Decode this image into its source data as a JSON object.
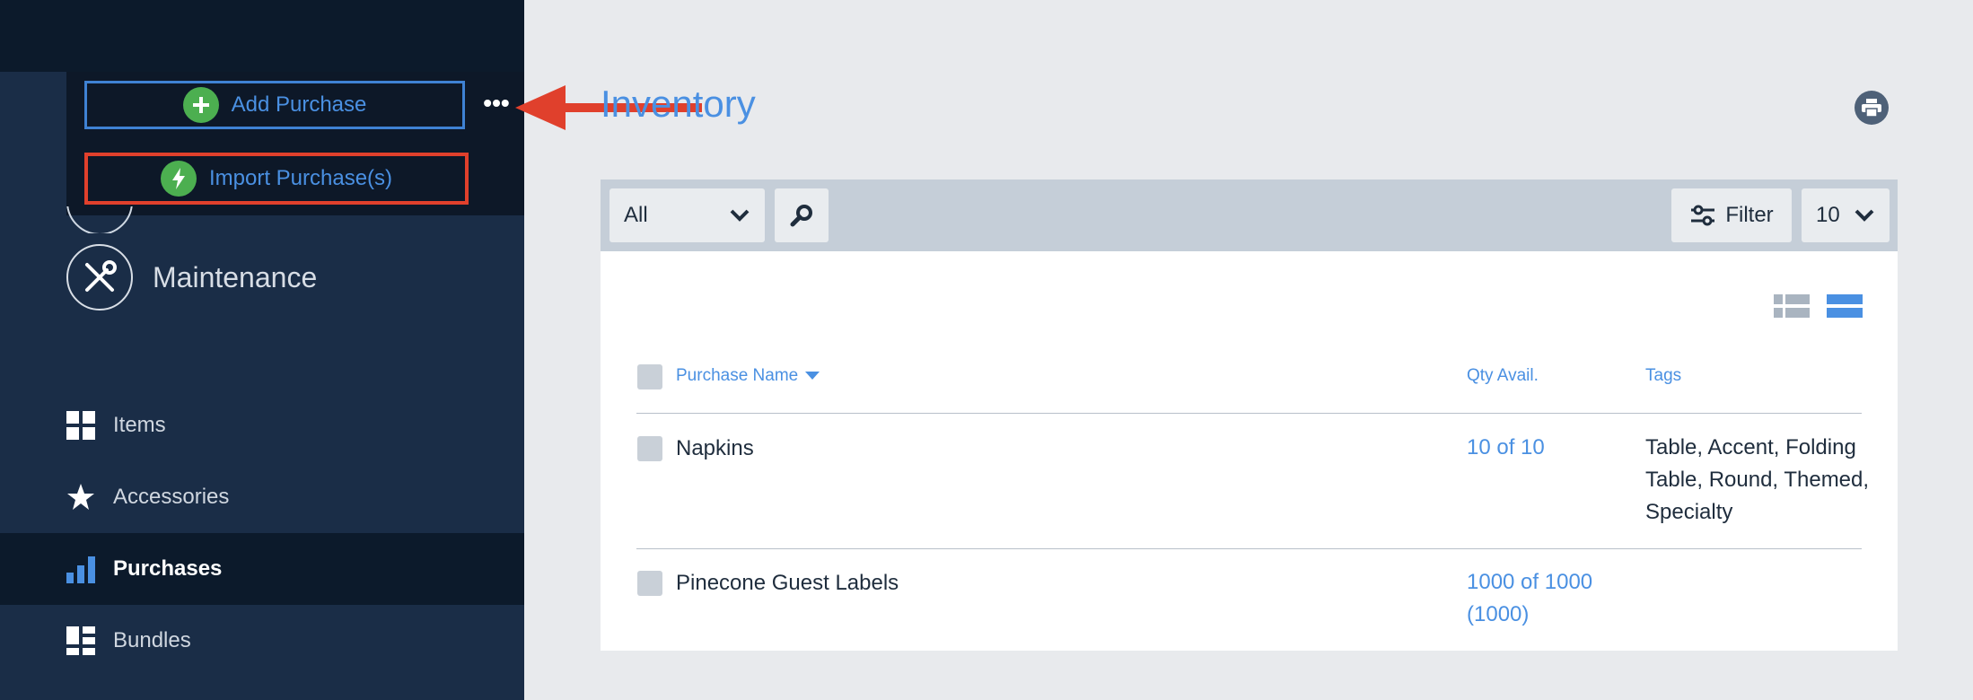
{
  "menu": {
    "add_label": "Add Purchase",
    "import_label": "Import Purchase(s)",
    "more_label": "•••"
  },
  "sidebar": {
    "maintenance_label": "Maintenance",
    "items": [
      {
        "label": "Items",
        "icon": "grid-icon",
        "active": false
      },
      {
        "label": "Accessories",
        "icon": "star-icon",
        "active": false
      },
      {
        "label": "Purchases",
        "icon": "bar-chart-icon",
        "active": true
      },
      {
        "label": "Bundles",
        "icon": "bundles-icon",
        "active": false
      }
    ]
  },
  "main": {
    "title": "Inventory",
    "toolbar": {
      "select_value": "All",
      "filter_label": "Filter",
      "page_size": "10"
    },
    "table": {
      "headers": {
        "name": "Purchase Name",
        "qty": "Qty Avail.",
        "tags": "Tags"
      },
      "rows": [
        {
          "name": "Napkins",
          "qty": "10 of 10",
          "tags": "Table, Accent, Folding Table, Round, Themed, Specialty"
        },
        {
          "name": "Pinecone Guest Labels",
          "qty": "1000 of 1000 (1000)",
          "tags": ""
        }
      ]
    }
  },
  "colors": {
    "sidebar_bg": "#1a2d47",
    "sidebar_dark": "#0c1a2b",
    "accent": "#4a90e2",
    "highlight_red": "#e0402c",
    "green": "#4caf50"
  }
}
